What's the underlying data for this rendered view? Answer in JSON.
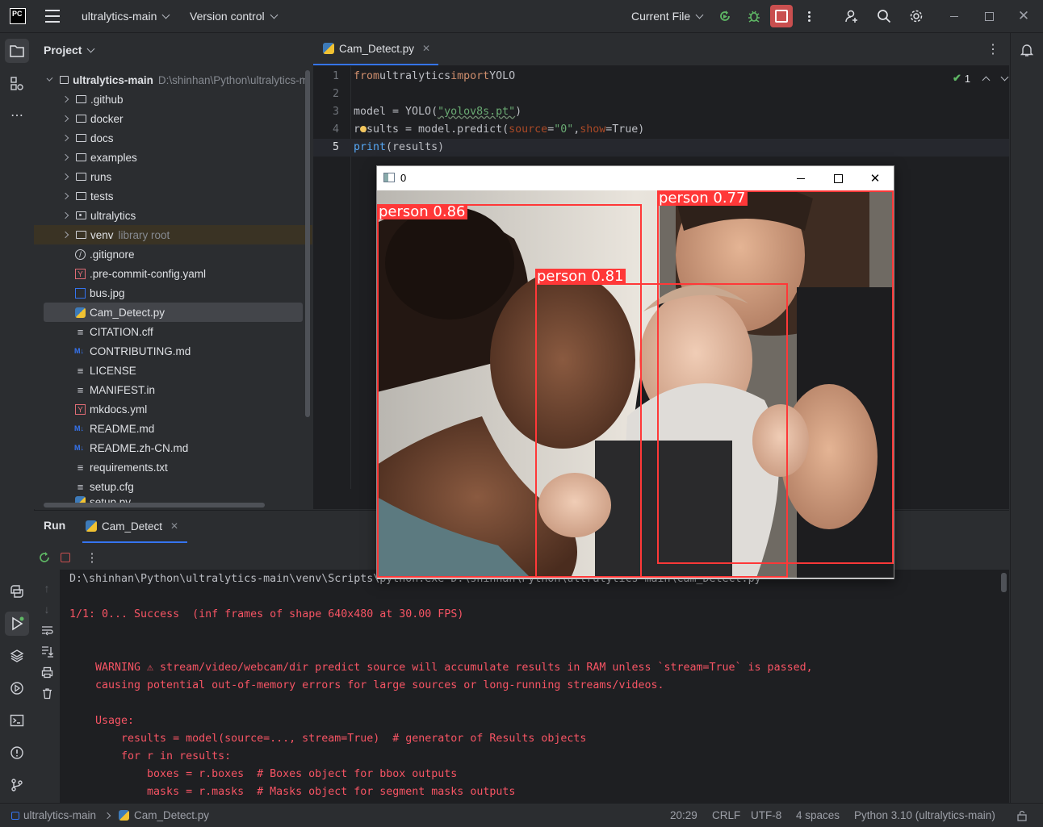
{
  "titlebar": {
    "logo": "PC",
    "menu_icon": "hamburger-icon",
    "project_name": "ultralytics-main",
    "vcs": "Version control",
    "run_config": "Current File"
  },
  "project_panel": {
    "title": "Project",
    "root_name": "ultralytics-main",
    "root_path": "D:\\shinhan\\Python\\ultralytics-m",
    "items": [
      {
        "label": "github",
        "prefix": ".",
        "type": "folder"
      },
      {
        "label": "docker",
        "prefix": "",
        "type": "folder"
      },
      {
        "label": "docs",
        "prefix": "",
        "type": "folder"
      },
      {
        "label": "examples",
        "prefix": "",
        "type": "folder"
      },
      {
        "label": "runs",
        "prefix": "",
        "type": "folder"
      },
      {
        "label": "tests",
        "prefix": "",
        "type": "folder"
      },
      {
        "label": "ultralytics",
        "prefix": "",
        "type": "package"
      },
      {
        "label": "venv",
        "prefix": "",
        "type": "folder",
        "note": "library root"
      },
      {
        "label": ".gitignore",
        "type": "ignore"
      },
      {
        "label": ".pre-commit-config.yaml",
        "type": "yaml"
      },
      {
        "label": "bus.jpg",
        "type": "image"
      },
      {
        "label": "Cam_Detect.py",
        "type": "python"
      },
      {
        "label": "CITATION.cff",
        "type": "text"
      },
      {
        "label": "CONTRIBUTING.md",
        "type": "md"
      },
      {
        "label": "LICENSE",
        "type": "text"
      },
      {
        "label": "MANIFEST.in",
        "type": "text"
      },
      {
        "label": "mkdocs.yml",
        "type": "yaml"
      },
      {
        "label": "README.md",
        "type": "md"
      },
      {
        "label": "README.zh-CN.md",
        "type": "md"
      },
      {
        "label": "requirements.txt",
        "type": "text"
      },
      {
        "label": "setup.cfg",
        "type": "text"
      },
      {
        "label": "setup.py",
        "type": "python"
      }
    ]
  },
  "editor": {
    "tab": "Cam_Detect.py",
    "inspection_count": "1",
    "lines": [
      {
        "n": "1"
      },
      {
        "n": "2"
      },
      {
        "n": "3"
      },
      {
        "n": "4"
      },
      {
        "n": "5"
      }
    ],
    "code": {
      "l1_kw1": "from",
      "l1_mod": " ultralytics ",
      "l1_kw2": "import",
      "l1_cls": " YOLO",
      "l3_a": "model = YOLO(",
      "l3_str": "\"yolov8s.pt\"",
      "l3_b": ")",
      "l4_a": "results = model.predict(",
      "l4_p1": "source",
      "l4_eq1": "=",
      "l4_s1": "\"0\"",
      "l4_c": ", ",
      "l4_p2": "show",
      "l4_eq2": "=True)",
      "l5_fn": "print",
      "l5_b": "(results)"
    }
  },
  "run_panel": {
    "title": "Run",
    "tab": "Cam_Detect",
    "console": {
      "cmd": "D:\\shinhan\\Python\\ultralytics-main\\venv\\Scripts\\python.exe D:\\shinhan\\Python\\ultralytics-main\\Cam_Detect.py",
      "l1": "1/1: 0... Success  (inf frames of shape 640x480 at 30.00 FPS)",
      "l2": "WARNING ⚠ stream/video/webcam/dir predict source will accumulate results in RAM unless `stream=True` is passed,",
      "l3": "causing potential out-of-memory errors for large sources or long-running streams/videos.",
      "l4": "Usage:",
      "l5": "    results = model(source=..., stream=True)  # generator of Results objects",
      "l6": "    for r in results:",
      "l7": "        boxes = r.boxes  # Boxes object for bbox outputs",
      "l8": "        masks = r.masks  # Masks object for segment masks outputs"
    }
  },
  "status_bar": {
    "project": "ultralytics-main",
    "file": "Cam_Detect.py",
    "position": "20:29",
    "line_sep": "CRLF",
    "encoding": "UTF-8",
    "indent": "4 spaces",
    "interpreter": "Python 3.10 (ultralytics-main)"
  },
  "cv_window": {
    "title": "0",
    "detections": [
      {
        "label": "person 0.86"
      },
      {
        "label": "person 0.77"
      },
      {
        "label": "person 0.81"
      }
    ]
  },
  "colors": {
    "accent": "#3574f0",
    "stop": "#c94f4f",
    "bbox": "#ff3838",
    "error_text": "#f75464"
  }
}
